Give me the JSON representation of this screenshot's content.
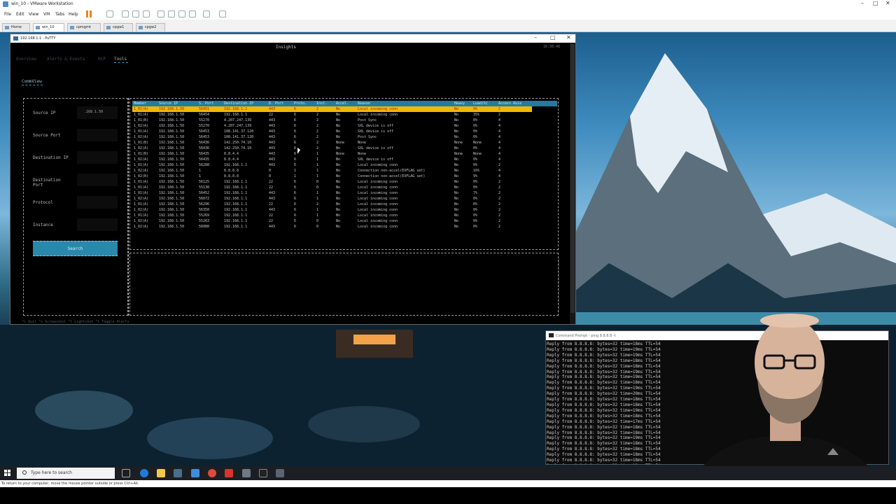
{
  "vmware": {
    "title": "win_10 - VMware Workstation",
    "menus": [
      "File",
      "Edit",
      "View",
      "VM",
      "Tabs",
      "Help"
    ],
    "tabs": [
      {
        "label": "Home"
      },
      {
        "label": "win_10"
      },
      {
        "label": "cpmgmt"
      },
      {
        "label": "cpgw1"
      },
      {
        "label": "cpgw2"
      }
    ],
    "status_text": "To return to your computer, move the mouse pointer outside or press Ctrl+Alt."
  },
  "putty": {
    "title": "192.168.1.1 - PuTTY",
    "app_title": "Insights",
    "clock": "16:38:48",
    "nav_tabs": [
      "Overview",
      "Alerts & Events",
      "RCP",
      "Tools"
    ],
    "active_tab": "Tools",
    "section_title": "CommView",
    "form": {
      "source_ip_label": "Source IP",
      "source_ip_value": ".168.1.50",
      "source_port_label": "Source Port",
      "dest_ip_label": "Destination IP",
      "dest_port_label": "Destination Port",
      "protocol_label": "Protocol",
      "instance_label": "Instance",
      "search_label": "Search"
    },
    "table": {
      "headers": [
        "Member",
        "Source IP",
        "S. Port",
        "Destination IP",
        "D. Port",
        "Proto.",
        "Inst.",
        "Accel.",
        "Reason",
        "Heavy",
        "Load(%)",
        "Access Rule"
      ],
      "rows": [
        [
          "1_01(A)",
          "192.168.1.50",
          "56451",
          "192.168.1.1",
          "443",
          "6",
          "2",
          "No",
          "Local incoming conn",
          "No",
          "0%",
          "2"
        ],
        [
          "1_01(A)",
          "192.168.1.50",
          "56454",
          "192.168.1.1",
          "22",
          "6",
          "2",
          "No",
          "Local incoming conn",
          "No",
          "35%",
          "2"
        ],
        [
          "1_01(B)",
          "192.168.1.50",
          "55270",
          "4.207.247.139",
          "443",
          "6",
          "2",
          "No",
          "Post Sync",
          "No",
          "0%",
          "4"
        ],
        [
          "1_02(A)",
          "192.168.1.50",
          "55270",
          "4.207.247.139",
          "443",
          "6",
          "2",
          "No",
          "SXL device is off",
          "No",
          "0%",
          "4"
        ],
        [
          "1_01(A)",
          "192.168.1.50",
          "56453",
          "108.141.37.120",
          "443",
          "6",
          "2",
          "No",
          "SXL device is off",
          "No",
          "0%",
          "4"
        ],
        [
          "1_02(A)",
          "192.168.1.50",
          "56453",
          "108.141.37.120",
          "443",
          "6",
          "2",
          "No",
          "Post Sync",
          "No",
          "0%",
          "4"
        ],
        [
          "1_01(B)",
          "192.168.1.50",
          "56436",
          "142.250.74.10",
          "443",
          "6",
          "2",
          "None",
          "None",
          "None",
          "None",
          "4"
        ],
        [
          "1_02(A)",
          "192.168.1.50",
          "56436",
          "142.250.74.10",
          "443",
          "6",
          "2",
          "No",
          "SXL device is off",
          "No",
          "0%",
          "4"
        ],
        [
          "1_01(B)",
          "192.168.1.50",
          "56435",
          "8.8.4.4",
          "443",
          "6",
          "1",
          "None",
          "None",
          "None",
          "None",
          "4"
        ],
        [
          "1_02(A)",
          "192.168.1.50",
          "56435",
          "8.8.4.4",
          "443",
          "6",
          "1",
          "No",
          "SXL device is off",
          "No",
          "0%",
          "4"
        ],
        [
          "1_01(A)",
          "192.168.1.50",
          "56288",
          "192.168.1.1",
          "443",
          "6",
          "1",
          "No",
          "Local incoming conn",
          "No",
          "0%",
          "2"
        ],
        [
          "1_02(A)",
          "192.168.1.50",
          "1",
          "8.8.8.8",
          "0",
          "1",
          "1",
          "No",
          "Connection non-accel(EXFLAG set)",
          "No",
          "16%",
          "4"
        ],
        [
          "1_02(B)",
          "192.168.1.50",
          "1",
          "8.8.8.8",
          "0",
          "1",
          "1",
          "No",
          "Connection non-accel(EXFLAG set)",
          "No",
          "9%",
          "4"
        ],
        [
          "1_01(A)",
          "192.168.1.50",
          "56125",
          "192.168.1.1",
          "22",
          "6",
          "0",
          "No",
          "Local incoming conn",
          "No",
          "0%",
          "2"
        ],
        [
          "1_01(A)",
          "192.168.1.50",
          "55130",
          "192.168.1.1",
          "22",
          "6",
          "0",
          "No",
          "Local incoming conn",
          "No",
          "0%",
          "2"
        ],
        [
          "1_01(A)",
          "192.168.1.50",
          "56452",
          "192.168.1.1",
          "443",
          "6",
          "1",
          "No",
          "Local incoming conn",
          "No",
          "7%",
          "2"
        ],
        [
          "1_02(A)",
          "192.168.1.50",
          "56072",
          "192.168.1.1",
          "443",
          "6",
          "1",
          "No",
          "Local incoming conn",
          "No",
          "0%",
          "2"
        ],
        [
          "1_01(A)",
          "192.168.1.50",
          "56296",
          "192.168.1.1",
          "22",
          "6",
          "2",
          "No",
          "Local incoming conn",
          "No",
          "0%",
          "2"
        ],
        [
          "1_02(A)",
          "192.168.1.50",
          "56350",
          "192.168.1.1",
          "443",
          "6",
          "1",
          "No",
          "Local incoming conn",
          "No",
          "0%",
          "2"
        ],
        [
          "1_01(A)",
          "192.168.1.50",
          "55269",
          "192.168.1.1",
          "22",
          "6",
          "1",
          "No",
          "Local incoming conn",
          "No",
          "0%",
          "2"
        ],
        [
          "1_02(A)",
          "192.168.1.50",
          "55263",
          "192.168.1.1",
          "22",
          "6",
          "0",
          "No",
          "Local incoming conn",
          "No",
          "0%",
          "2"
        ],
        [
          "1_02(A)",
          "192.168.1.50",
          "56080",
          "192.168.1.1",
          "443",
          "6",
          "0",
          "No",
          "Local incoming conn",
          "No",
          "0%",
          "2"
        ]
      ]
    },
    "footer": "^c Quit  ^s Screenshot  ^l Lightshot  ^t Toggle Alerts"
  },
  "cmd": {
    "title": "Command Prompt - ping 8.8.8.8 -t",
    "lines": [
      "Reply from 8.8.8.8: bytes=32 time=18ms TTL=54",
      "Reply from 8.8.8.8: bytes=32 time=19ms TTL=54",
      "Reply from 8.8.8.8: bytes=32 time=19ms TTL=54",
      "Reply from 8.8.8.8: bytes=32 time=18ms TTL=54",
      "Reply from 8.8.8.8: bytes=32 time=18ms TTL=54",
      "Reply from 8.8.8.8: bytes=32 time=19ms TTL=54",
      "Reply from 8.8.8.8: bytes=32 time=19ms TTL=54",
      "Reply from 8.8.8.8: bytes=32 time=18ms TTL=54",
      "Reply from 8.8.8.8: bytes=32 time=19ms TTL=54",
      "Reply from 8.8.8.8: bytes=32 time=20ms TTL=54",
      "Reply from 8.8.8.8: bytes=32 time=18ms TTL=54",
      "Reply from 8.8.8.8: bytes=32 time=18ms TTL=54",
      "Reply from 8.8.8.8: bytes=32 time=19ms TTL=54",
      "Reply from 8.8.8.8: bytes=32 time=18ms TTL=54",
      "Reply from 8.8.8.8: bytes=32 time=17ms TTL=54",
      "Reply from 8.8.8.8: bytes=32 time=18ms TTL=54",
      "Reply from 8.8.8.8: bytes=32 time=18ms TTL=54",
      "Reply from 8.8.8.8: bytes=32 time=19ms TTL=54",
      "Reply from 8.8.8.8: bytes=32 time=18ms TTL=54",
      "Reply from 8.8.8.8: bytes=32 time=18ms TTL=54",
      "Reply from 8.8.8.8: bytes=32 time=18ms TTL=54",
      "Reply from 8.8.8.8: bytes=32 time=18ms TTL=54",
      "Reply from 8.8.8.8: bytes=32 time=18ms TTL=54"
    ]
  },
  "taskbar": {
    "search_placeholder": "Type here to search"
  },
  "colors": {
    "accent": "#2a88ad",
    "selection": "#f2b705",
    "selected_text": "#a81b1b",
    "header_bg": "#1f7e9e"
  }
}
